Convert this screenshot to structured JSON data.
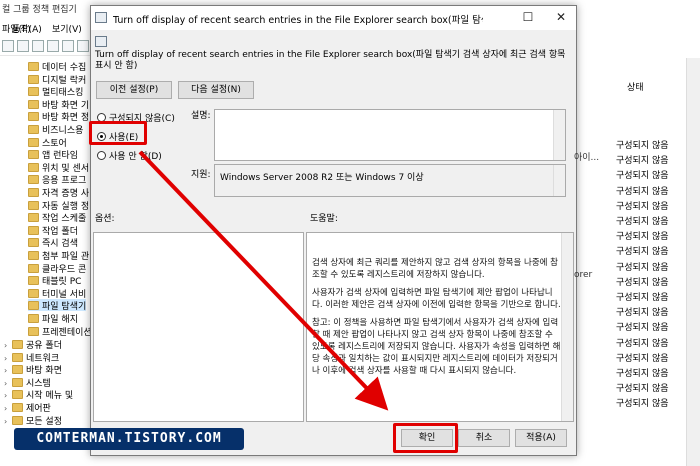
{
  "background_window": {
    "title": "컬 그룹 정책 편집기",
    "menu": [
      "파일(F)",
      "동작(A)",
      "보기(V)"
    ],
    "tree_items": [
      "데이터 수집",
      "디지털 락커",
      "멀티태스킹",
      "바탕 화면 기",
      "바탕 화면 정",
      "비즈니스용",
      "스토어",
      "앱 런타임",
      "위치 및 센서",
      "응용 프로그",
      "자격 증명 사",
      "자동 실행 정",
      "작업 스케줄",
      "작업 폴더",
      "즉시 검색",
      "첨부 파일 관",
      "클라우드 콘",
      "태블릿 PC",
      "터미널 서비",
      "파일 탐색기",
      "파일 해지",
      "프레젠테이션"
    ],
    "bottom_tree_items": [
      "공유 폴더",
      "네트워크",
      "바탕 화면",
      "시스템",
      "시작 메뉴 및",
      "제어판",
      "모든 설정"
    ],
    "right_pane": {
      "header": "상태",
      "rows": [
        "구성되지 않음",
        "구성되지 않음",
        "구성되지 않음",
        "구성되지 않음",
        "구성되지 않음",
        "구성되지 않음",
        "구성되지 않음",
        "구성되지 않음",
        "구성되지 않음",
        "구성되지 않음",
        "구성되지 않음",
        "구성되지 않음",
        "구성되지 않음",
        "구성되지 않음",
        "구성되지 않음",
        "구성되지 않음",
        "구성되지 않음",
        "구성되지 않음"
      ],
      "fragments": [
        "아이...",
        "orer"
      ]
    }
  },
  "dialog": {
    "title": "Turn off display of recent search entries in the File Explorer search box(파일 탐색기 검색 상자...",
    "policy_title": "Turn off display of recent search entries in the File Explorer search box(파일 탐색기 검색 상자에 최근 검색 항목 표시 안 함)",
    "prev_button": "이전 설정(P)",
    "next_button": "다음 설정(N)",
    "radio_not_configured": "구성되지 않음(C)",
    "radio_enabled": "사용(E)",
    "radio_disabled": "사용 안 함(D)",
    "comment_label": "설명:",
    "supported_label": "지원:",
    "supported_value": "Windows Server 2008 R2 또는 Windows 7 이상",
    "options_label": "옵션:",
    "help_label": "도움말:",
    "help_paragraphs": [
      "검색 상자에 최근 쿼리를 제안하지 않고 검색 상자의 항목을 나중에 참조할 수 있도록 레지스트리에 저장하지 않습니다.",
      "사용자가 검색 상자에 입력하면 파일 탐색기에 제안 팝업이 나타납니다. 이러한 제안은 검색 상자에 이전에 입력한 항목을 기반으로 합니다.",
      "참고: 이 정책을 사용하면 파일 탐색기에서 사용자가 검색 상자에 입력할 때 제안 팝업이 나타나지 않고 검색 상자 항목이 나중에 참조할 수 있도록 레지스트리에 저장되지 않습니다. 사용자가 속성을 입력하면 해당 속성과 일치하는 값이 표시되지만 레지스트리에 데이터가 저장되거나 이후에 검색 상자를 사용할 때 다시 표시되지 않습니다."
    ],
    "ok_button": "확인",
    "cancel_button": "취소",
    "apply_button": "적용(A)",
    "close_glyph": "✕",
    "max_glyph": "☐"
  },
  "watermark": "COMTERMAN.TISTORY.COM",
  "colors": {
    "annotation_red": "#e00000",
    "watermark_bg": "#06306a"
  }
}
